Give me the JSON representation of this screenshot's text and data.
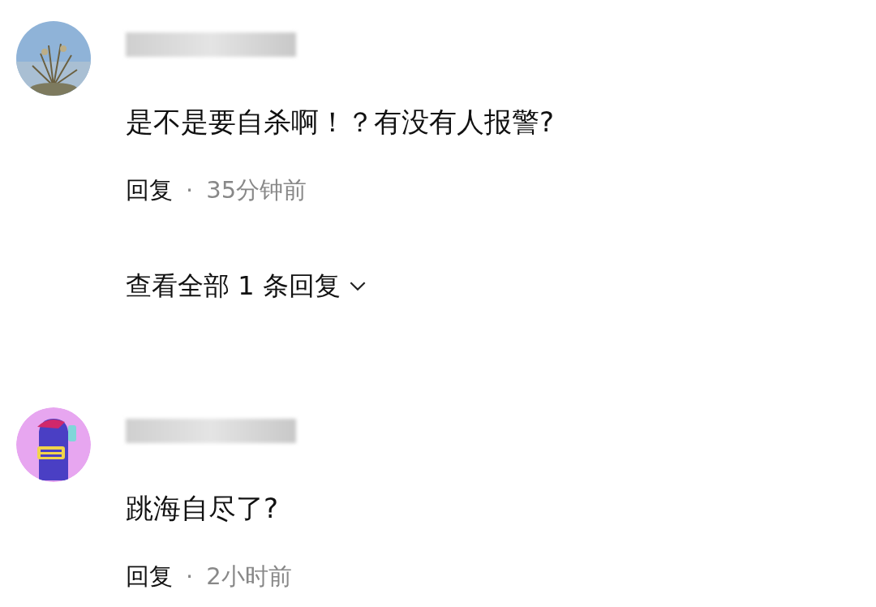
{
  "comments": [
    {
      "text": "是不是要自杀啊！？有没有人报警?",
      "reply_label": "回复",
      "separator": "·",
      "time": "35分钟前",
      "view_replies": "查看全部 1 条回复"
    },
    {
      "avatar": {
        "kind": "cartoon"
      },
      "text": "跳海自尽了?",
      "reply_label": "回复",
      "separator": "·",
      "time": "2小时前"
    }
  ]
}
